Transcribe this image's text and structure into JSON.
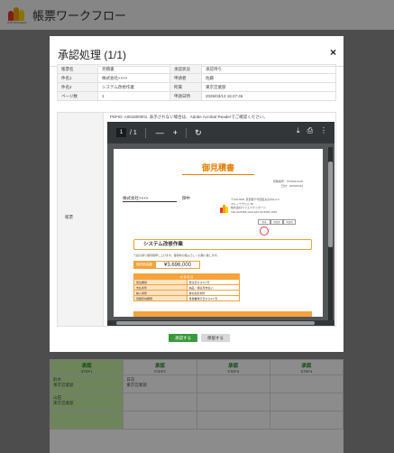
{
  "app": {
    "title": "帳票ワークフロー",
    "logo_text": "HTR Workpaper"
  },
  "modal": {
    "title": "承認処理 (1/1)",
    "close": "×",
    "info": [
      {
        "label": "帳票名",
        "value": "見積書",
        "label2": "承認状況",
        "value2": "承認待ち"
      },
      {
        "label": "件名1",
        "value": "株式会社××××",
        "label2": "申請者",
        "value2": "佐藤"
      },
      {
        "label": "件名2",
        "value": "システム改修作業",
        "label2": "所属",
        "value2": "東京営業部"
      },
      {
        "label": "ページ数",
        "value": "1",
        "label2": "申請日時",
        "value2": "2025/03/13 16:47:46"
      }
    ],
    "form_label": "帳票",
    "pdf_note": "PDFID: A001800001. 表示されない場合は、Adobe Acrobat Readerでご確認ください。",
    "viewer": {
      "page_current": "1",
      "page_total": "/ 1",
      "minus": "—",
      "plus": "+",
      "rotate_icon": "↻",
      "download_icon": "⤓",
      "print_icon": "⎙",
      "more_icon": "⋮"
    },
    "document": {
      "title": "御見積書",
      "doc_no": [
        "見積番号：ST250313-06",
        "日付：2025/03/13"
      ],
      "customer": "株式会社××××",
      "honorific": "御中",
      "address": [
        "〒100-0001 東京都千代田区丸の内1-2-3",
        "マルノウチビル 5F",
        "株式会社ワイエスケイボード",
        "TEL 03-5555-1234 FAX 03-5555-1235"
      ],
      "stamps": [
        "担当",
        "承認者",
        "承認者"
      ],
      "subject": "システム改修作業",
      "notice": "下記の通り御見積申し上げます。御用命の程よろしくお願い致します。",
      "total_label": "御見積金額",
      "total_value": "¥3,696,000",
      "detail_header": "内 容 項 目",
      "details": [
        {
          "k": "受注期間",
          "v": "受注日から3ヶ月"
        },
        {
          "k": "支払条件",
          "v": "納品・検収月末払い"
        },
        {
          "k": "納入場所",
          "v": "貴社指定場所"
        },
        {
          "k": "見積有効期限",
          "v": "見積書発行日から3ヶ月"
        }
      ]
    },
    "buttons": {
      "approve": "承認する",
      "hold": "保留する"
    }
  },
  "steps": {
    "headers": [
      {
        "title": "承認",
        "step": "STEP1"
      },
      {
        "title": "承認",
        "step": "STEP2"
      },
      {
        "title": "承認",
        "step": "STEP3"
      },
      {
        "title": "承認",
        "step": "STEP4"
      }
    ],
    "row1": [
      "鈴木\n東京営業部",
      "日向\n東京営業部",
      "",
      ""
    ],
    "row2": [
      "山田\n東京営業部",
      "",
      "",
      ""
    ]
  }
}
